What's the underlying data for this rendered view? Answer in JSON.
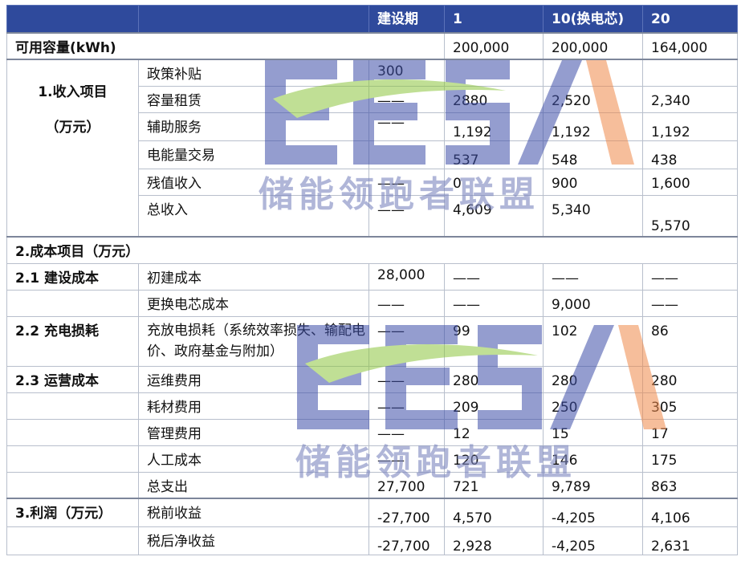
{
  "header": [
    "",
    "",
    "建设期",
    "1",
    "10(换电芯)",
    "20"
  ],
  "capacity": {
    "label": "可用容量(kWh)",
    "values": [
      "",
      "200,000",
      "200,000",
      "164,000"
    ]
  },
  "income": {
    "group": [
      "1.收入项目",
      "（万元）"
    ],
    "rows": [
      {
        "item": "政策补贴",
        "values": [
          "300",
          "",
          "",
          ""
        ]
      },
      {
        "item": "容量租赁",
        "values": [
          "——",
          "2880",
          "2,520",
          "2,340"
        ]
      },
      {
        "item": "辅助服务",
        "values": [
          "——",
          "1,192",
          "1,192",
          "1,192"
        ]
      },
      {
        "item": "电能量交易",
        "values": [
          "",
          "537",
          "548",
          "438"
        ]
      },
      {
        "item": "残值收入",
        "values": [
          "——",
          "0",
          "900",
          "1,600"
        ]
      },
      {
        "item": "总收入",
        "values": [
          "——",
          "4,609",
          "5,340",
          "5,570"
        ]
      }
    ]
  },
  "cost_title": "2.成本项目（万元）",
  "build": {
    "group": "2.1 建设成本",
    "rows": [
      {
        "item": "初建成本",
        "values": [
          "28,000",
          "——",
          "——",
          "——"
        ]
      },
      {
        "item": "更换电芯成本",
        "values": [
          "——",
          "——",
          "9,000",
          "——"
        ]
      }
    ]
  },
  "charge": {
    "group": "2.2 充电损耗",
    "item": "充放电损耗（系统效率损失、输配电价、政府基金与附加）",
    "values": [
      "——",
      "99",
      "102",
      "86"
    ]
  },
  "ops": {
    "group": "2.3 运营成本",
    "rows": [
      {
        "item": "运维费用",
        "values": [
          "——",
          "280",
          "280",
          "280"
        ]
      },
      {
        "item": "耗材费用",
        "values": [
          "——",
          "209",
          "250",
          "305"
        ]
      },
      {
        "item": "管理费用",
        "values": [
          "——",
          "12",
          "15",
          "17"
        ]
      },
      {
        "item": "人工成本",
        "values": [
          "——",
          "120",
          "146",
          "175"
        ]
      },
      {
        "item": "总支出",
        "values": [
          "27,700",
          "721",
          "9,789",
          "863"
        ]
      }
    ]
  },
  "profit": {
    "group": "3.利润（万元）",
    "rows": [
      {
        "item": "税前收益",
        "values": [
          "-27,700",
          "4,570",
          "-4,205",
          "4,106"
        ]
      },
      {
        "item": "税后净收益",
        "values": [
          "-27,700",
          "2,928",
          "-4,205",
          "2,631"
        ]
      }
    ]
  },
  "watermark": {
    "logo": "EESA",
    "text": "储能领跑者联盟"
  },
  "colors": {
    "header_bg": "#2f4a9c",
    "logo_blue": "#3d4ea8",
    "logo_green": "#8ec63f",
    "logo_orange": "#f08a4b"
  }
}
